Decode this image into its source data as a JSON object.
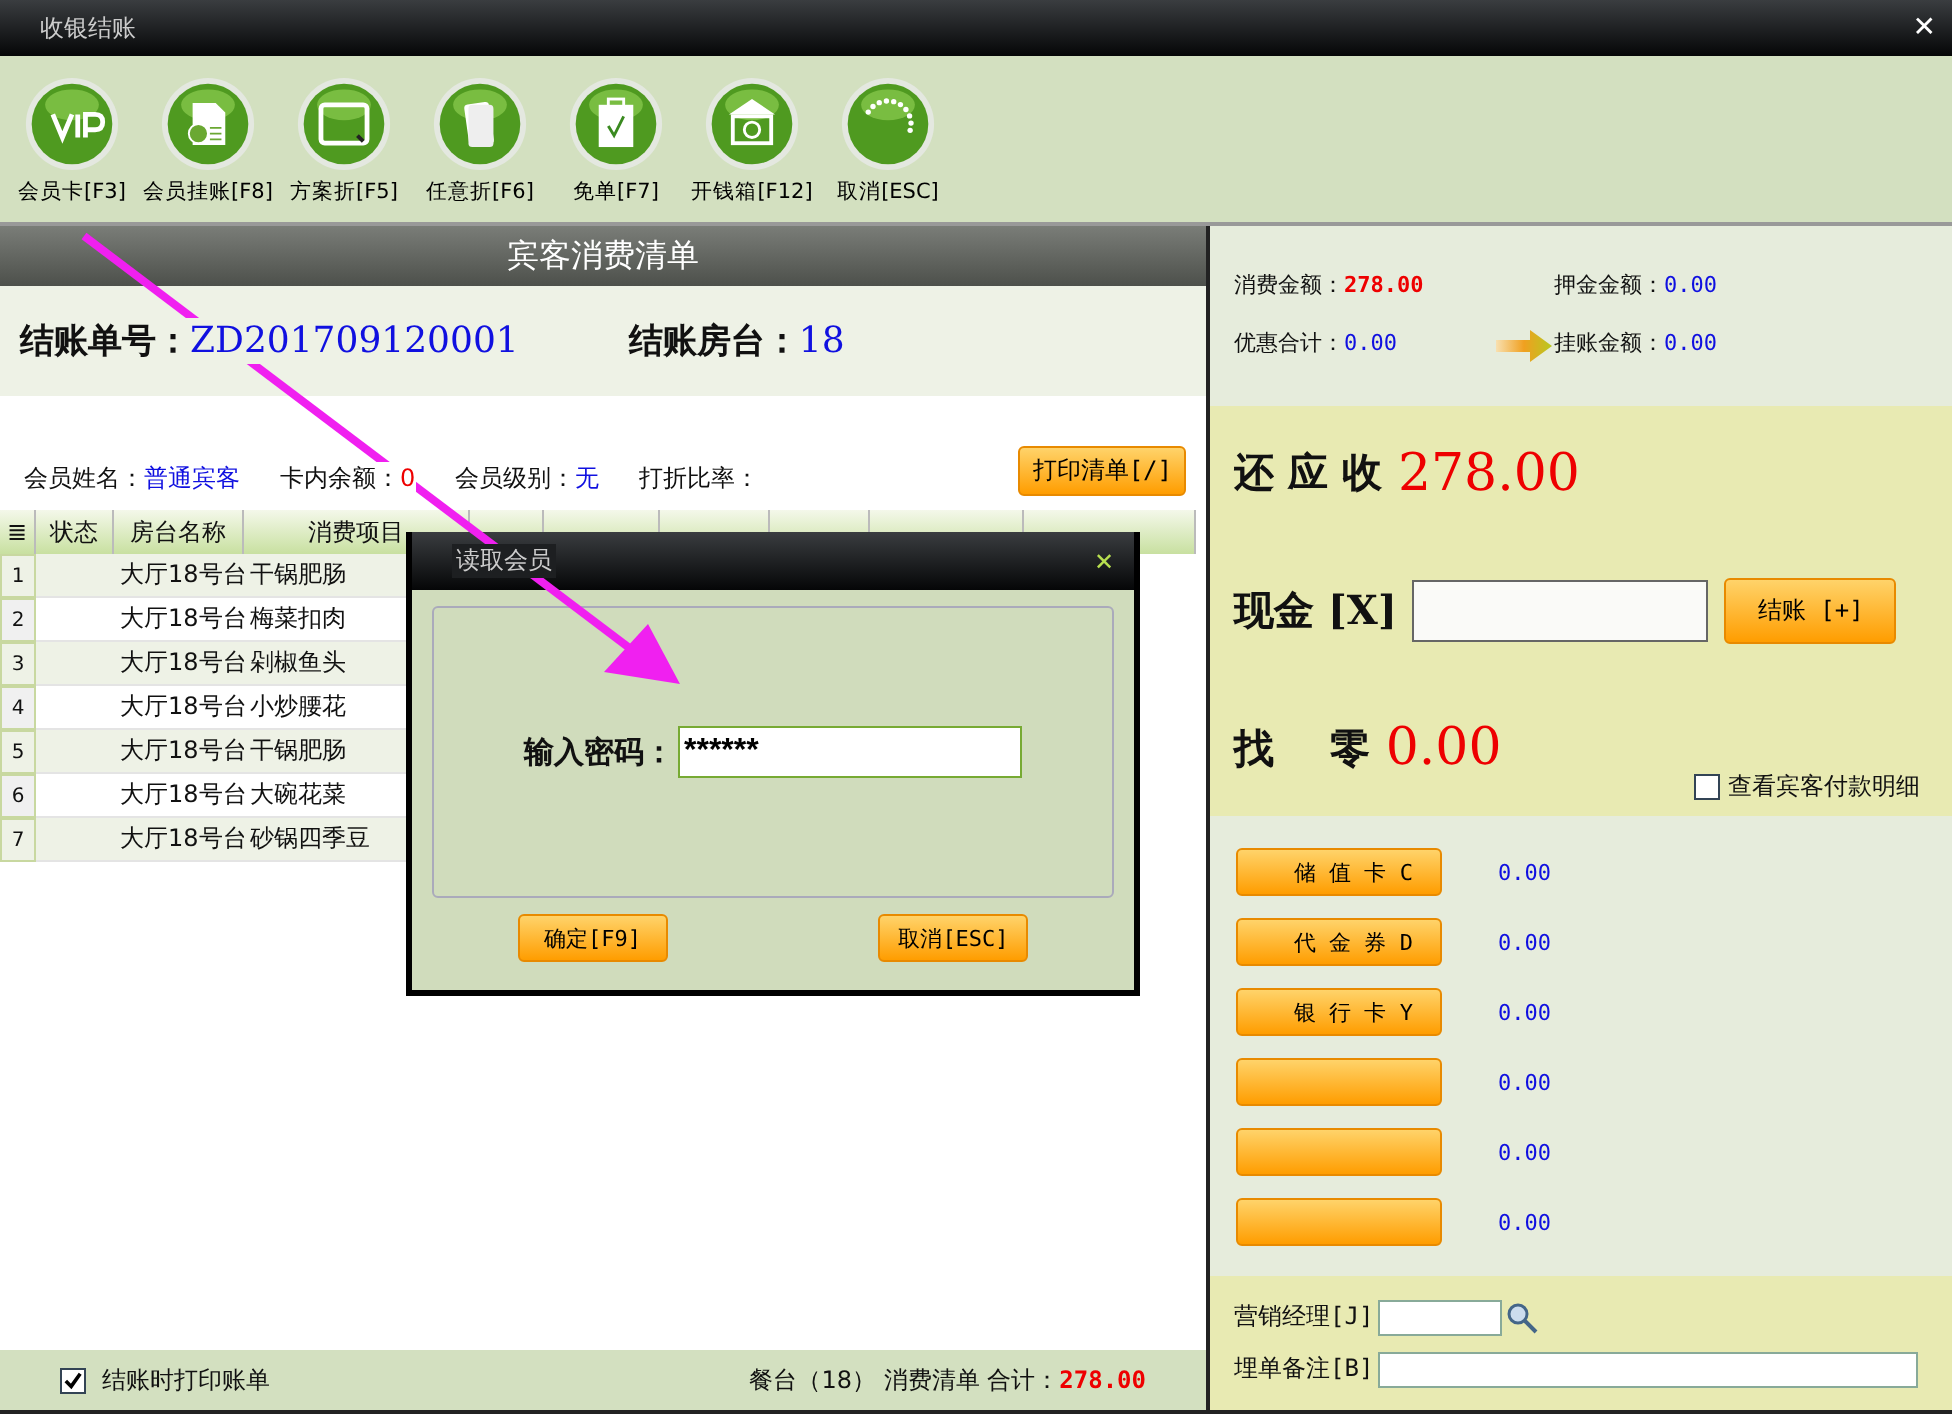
{
  "window": {
    "title": "收银结账",
    "close": "✕"
  },
  "toolbar": [
    {
      "label": "会员卡[F3]"
    },
    {
      "label": "会员挂账[F8]"
    },
    {
      "label": "方案折[F5]"
    },
    {
      "label": "任意折[F6]"
    },
    {
      "label": "免单[F7]"
    },
    {
      "label": "开钱箱[F12]"
    },
    {
      "label": "取消[ESC]"
    }
  ],
  "bill": {
    "title": "宾客消费清单",
    "number_label": "结账单号：",
    "number": "ZD201709120001",
    "room_label": "结账房台：",
    "room": "18"
  },
  "member": {
    "name_label": "会员姓名：",
    "name": "普通宾客",
    "balance_label": "卡内余额：",
    "balance": "0",
    "level_label": "会员级别：",
    "level_value": "无",
    "discount_label": "打折比率：",
    "print_button": "打印清单[/]"
  },
  "table": {
    "columns": [
      "≣",
      "状态",
      "房台名称",
      "消费项目"
    ],
    "rows": [
      [
        "1",
        "",
        "大厅18号台",
        "干锅肥肠"
      ],
      [
        "2",
        "",
        "大厅18号台",
        "梅菜扣肉"
      ],
      [
        "3",
        "",
        "大厅18号台",
        "剁椒鱼头"
      ],
      [
        "4",
        "",
        "大厅18号台",
        "小炒腰花"
      ],
      [
        "5",
        "",
        "大厅18号台",
        "干锅肥肠"
      ],
      [
        "6",
        "",
        "大厅18号台",
        "大碗花菜"
      ],
      [
        "7",
        "",
        "大厅18号台",
        "砂锅四季豆"
      ]
    ]
  },
  "footer": {
    "print_on_checkout": {
      "label": "结账时打印账单",
      "checked": true
    },
    "summary": "餐台（18） 消费清单 合计：",
    "total": "278.00"
  },
  "summary": {
    "consumption_label": "消费金额：",
    "consumption": "278.00",
    "deposit_label": "押金金额：",
    "deposit": "0.00",
    "discount_label": "优惠合计：",
    "discount": "0.00",
    "credit_label": "挂账金额：",
    "credit": "0.00"
  },
  "payment": {
    "due_label": "还 应 收",
    "due": "278.00",
    "cash_label": "现金 [X]",
    "checkout_button": "结账 [+]",
    "change_label": "找    零",
    "change": "0.00",
    "details": {
      "label": "查看宾客付款明细",
      "checked": false
    }
  },
  "methods": [
    {
      "label": "储 值 卡 C",
      "amount": "0.00"
    },
    {
      "label": "代 金 券 D",
      "amount": "0.00"
    },
    {
      "label": "银 行 卡 Y",
      "amount": "0.00"
    },
    {
      "amount": "0.00"
    },
    {
      "amount": "0.00"
    },
    {
      "amount": "0.00"
    }
  ],
  "extra": {
    "manager_label": "营销经理[J]",
    "note_label": "埋单备注[B]"
  },
  "dialog": {
    "title": "读取会员",
    "close": "✕",
    "password_label": "输入密码：",
    "password": "******",
    "ok_button": "确定[F9]",
    "cancel_button": "取消[ESC]"
  }
}
